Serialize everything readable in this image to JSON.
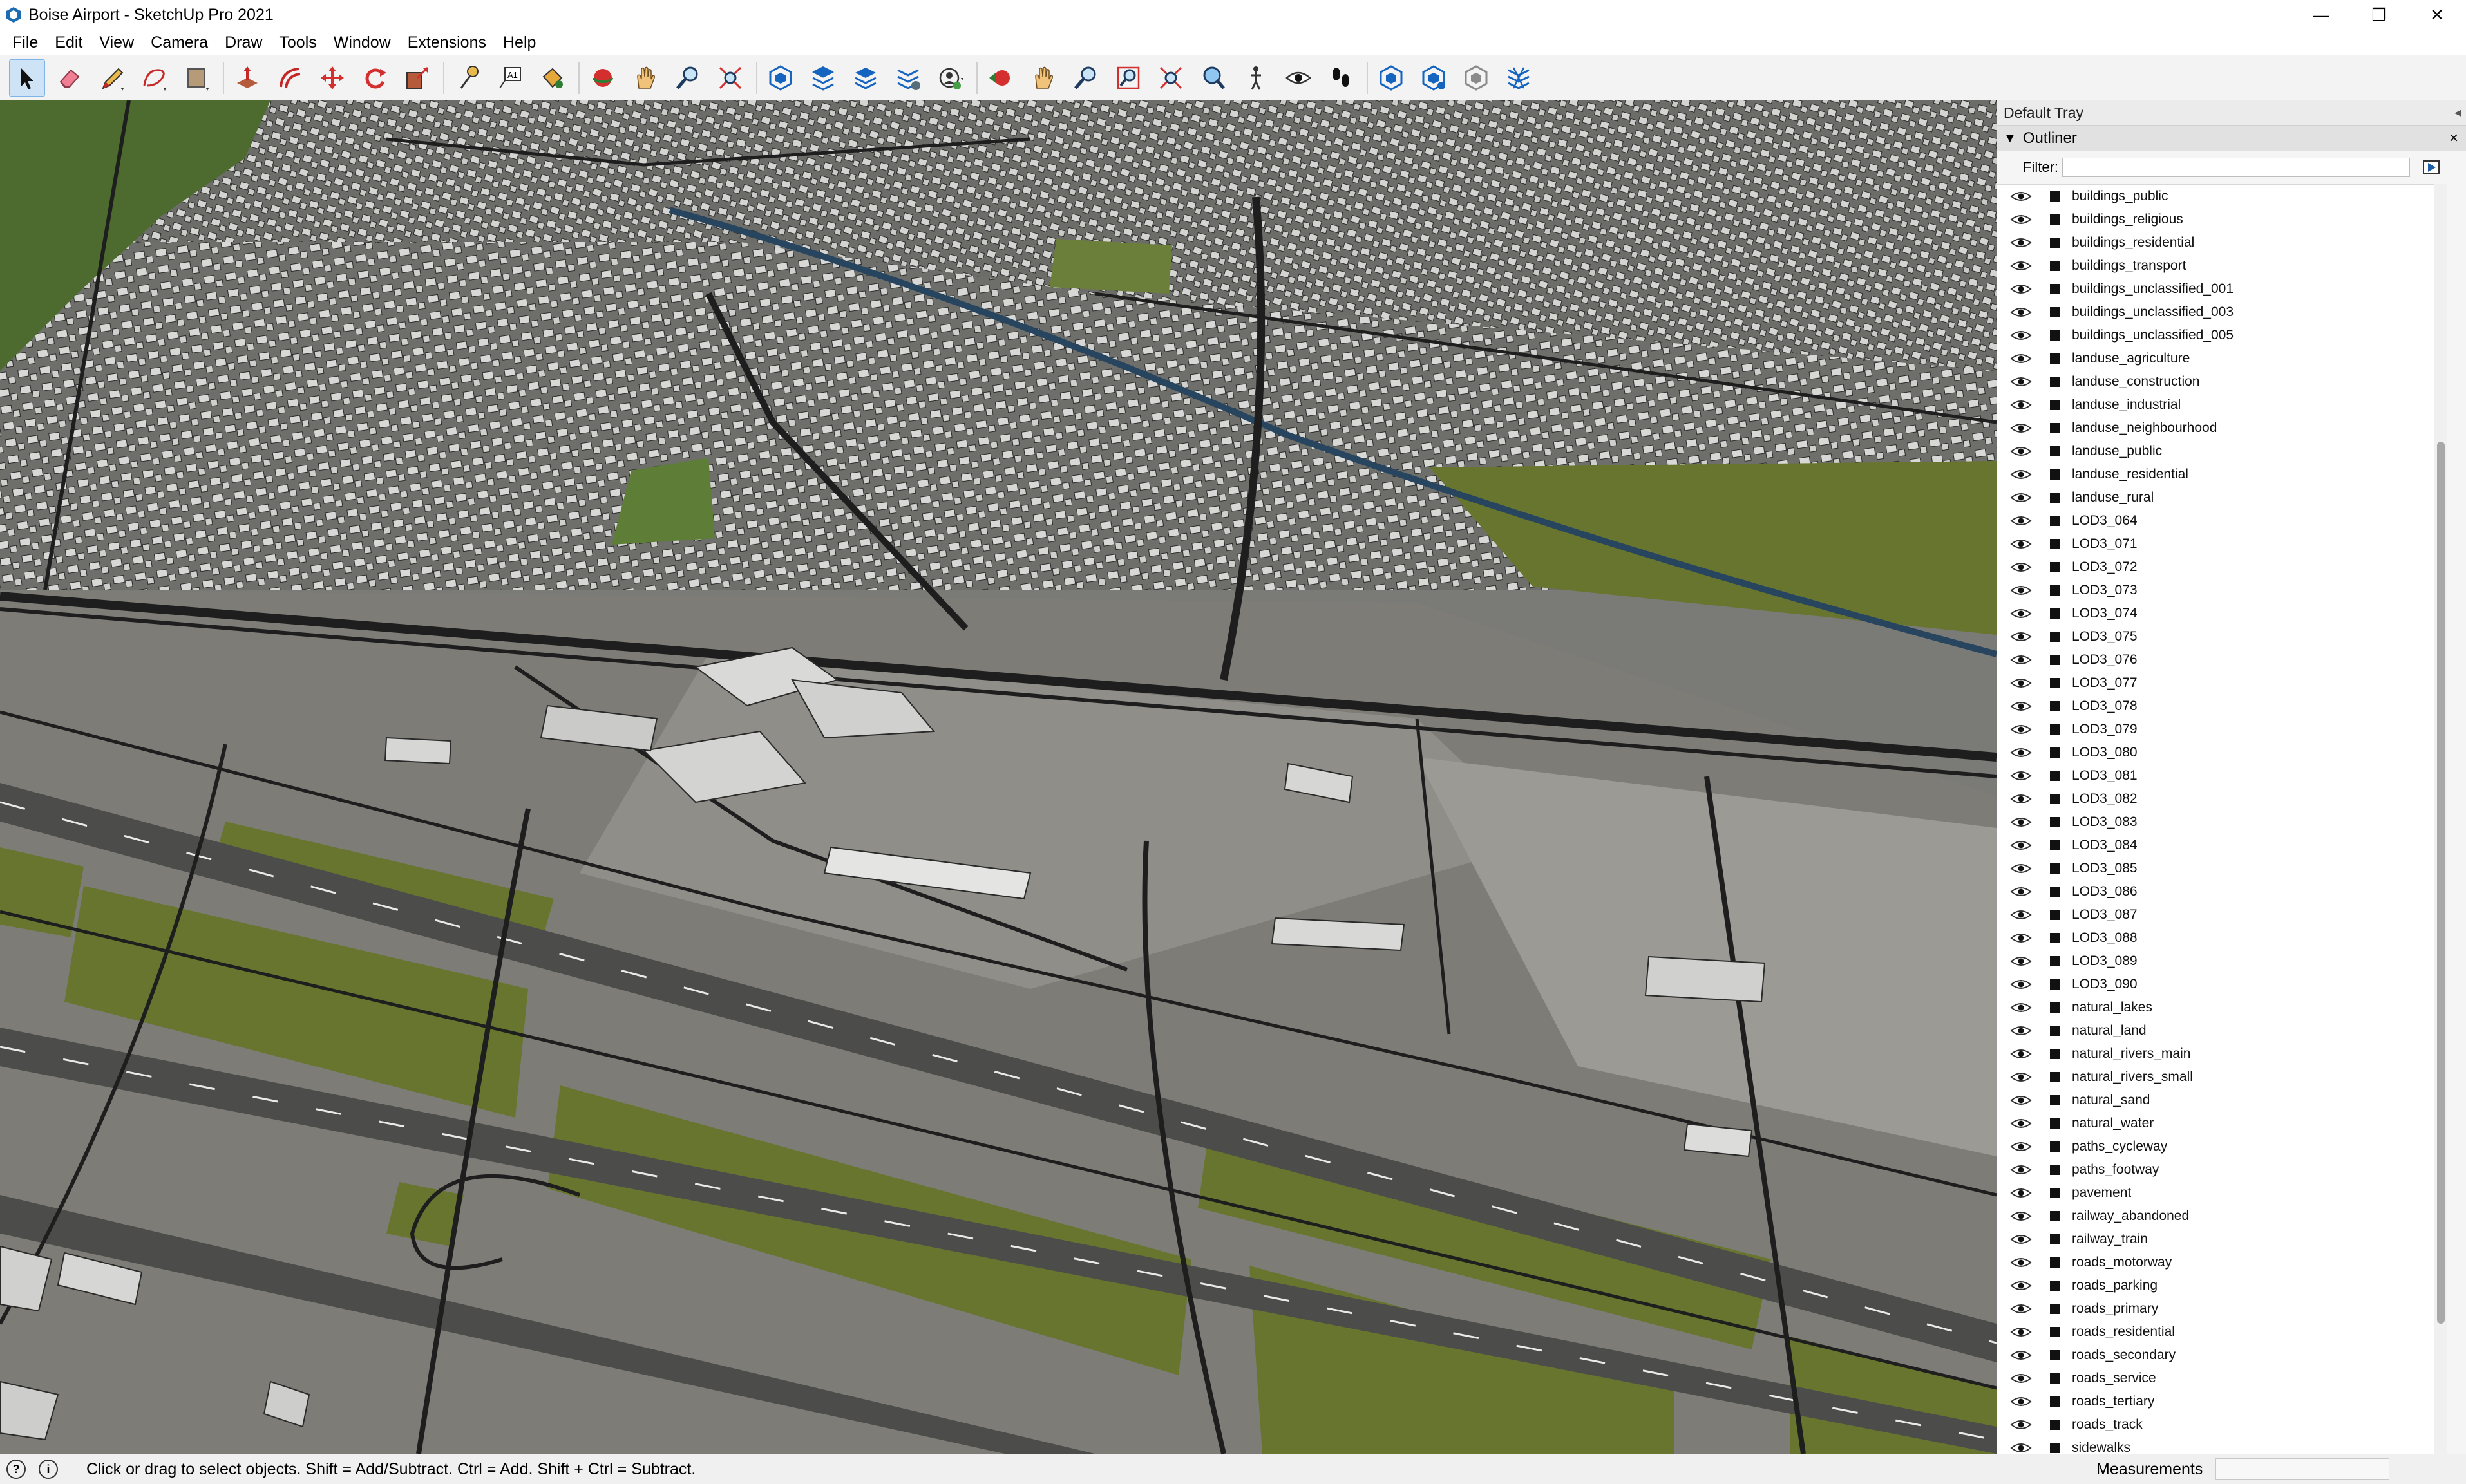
{
  "window": {
    "title": "Boise Airport - SketchUp Pro 2021",
    "controls": [
      "—",
      "❐",
      "✕"
    ]
  },
  "menu": [
    "File",
    "Edit",
    "View",
    "Camera",
    "Draw",
    "Tools",
    "Window",
    "Extensions",
    "Help"
  ],
  "toolbar": {
    "tools": [
      "select-icon",
      "eraser-icon",
      "pencil-line-icon",
      "freehand-shape-icon",
      "rectangle-icon",
      "push-pull-icon",
      "offset-icon",
      "move-icon",
      "rotate-icon",
      "scale-icon",
      "tape-measure-icon",
      "text-icon",
      "paint-bucket-icon",
      "orbit-icon",
      "pan-icon",
      "zoom-icon",
      "zoom-extents-icon",
      "warehouse-icon",
      "extension-1-icon",
      "extension-2-icon",
      "extension-3-icon",
      "user-account-icon",
      "previous-view-icon",
      "hand-icon",
      "zoom-in-icon",
      "zoom-window-icon",
      "zoom-fit-icon",
      "magnify-icon",
      "position-camera-icon",
      "look-around-icon",
      "walk-icon",
      "extension-4-icon",
      "extension-5-icon",
      "extension-6-icon",
      "extension-7-icon"
    ],
    "colors": {
      "active": "#cfe3f7"
    }
  },
  "tray": {
    "title": "Default Tray",
    "panel_title": "Outliner",
    "filter_label": "Filter:",
    "filter_value": "",
    "items": [
      "buildings_public",
      "buildings_religious",
      "buildings_residential",
      "buildings_transport",
      "buildings_unclassified_001",
      "buildings_unclassified_003",
      "buildings_unclassified_005",
      "landuse_agriculture",
      "landuse_construction",
      "landuse_industrial",
      "landuse_neighbourhood",
      "landuse_public",
      "landuse_residential",
      "landuse_rural",
      "LOD3_064",
      "LOD3_071",
      "LOD3_072",
      "LOD3_073",
      "LOD3_074",
      "LOD3_075",
      "LOD3_076",
      "LOD3_077",
      "LOD3_078",
      "LOD3_079",
      "LOD3_080",
      "LOD3_081",
      "LOD3_082",
      "LOD3_083",
      "LOD3_084",
      "LOD3_085",
      "LOD3_086",
      "LOD3_087",
      "LOD3_088",
      "LOD3_089",
      "LOD3_090",
      "natural_lakes",
      "natural_land",
      "natural_rivers_main",
      "natural_rivers_small",
      "natural_sand",
      "natural_water",
      "paths_cycleway",
      "paths_footway",
      "pavement",
      "railway_abandoned",
      "railway_train",
      "roads_motorway",
      "roads_parking",
      "roads_primary",
      "roads_residential",
      "roads_secondary",
      "roads_service",
      "roads_tertiary",
      "roads_track",
      "sidewalks"
    ]
  },
  "status": {
    "text": "Click or drag to select objects. Shift = Add/Subtract. Ctrl = Add. Shift + Ctrl = Subtract.",
    "icons": [
      "geo-location-icon",
      "info-icon"
    ],
    "measurements_label": "Measurements",
    "measurements_value": ""
  },
  "viewport": {
    "colors": {
      "ground": "#7b7a75",
      "grass": "#68752f",
      "pavement": "#a3a39e",
      "roads": "#1e1e1e",
      "buildings": "#d6d6d6",
      "water": "#2f4f6e"
    }
  }
}
